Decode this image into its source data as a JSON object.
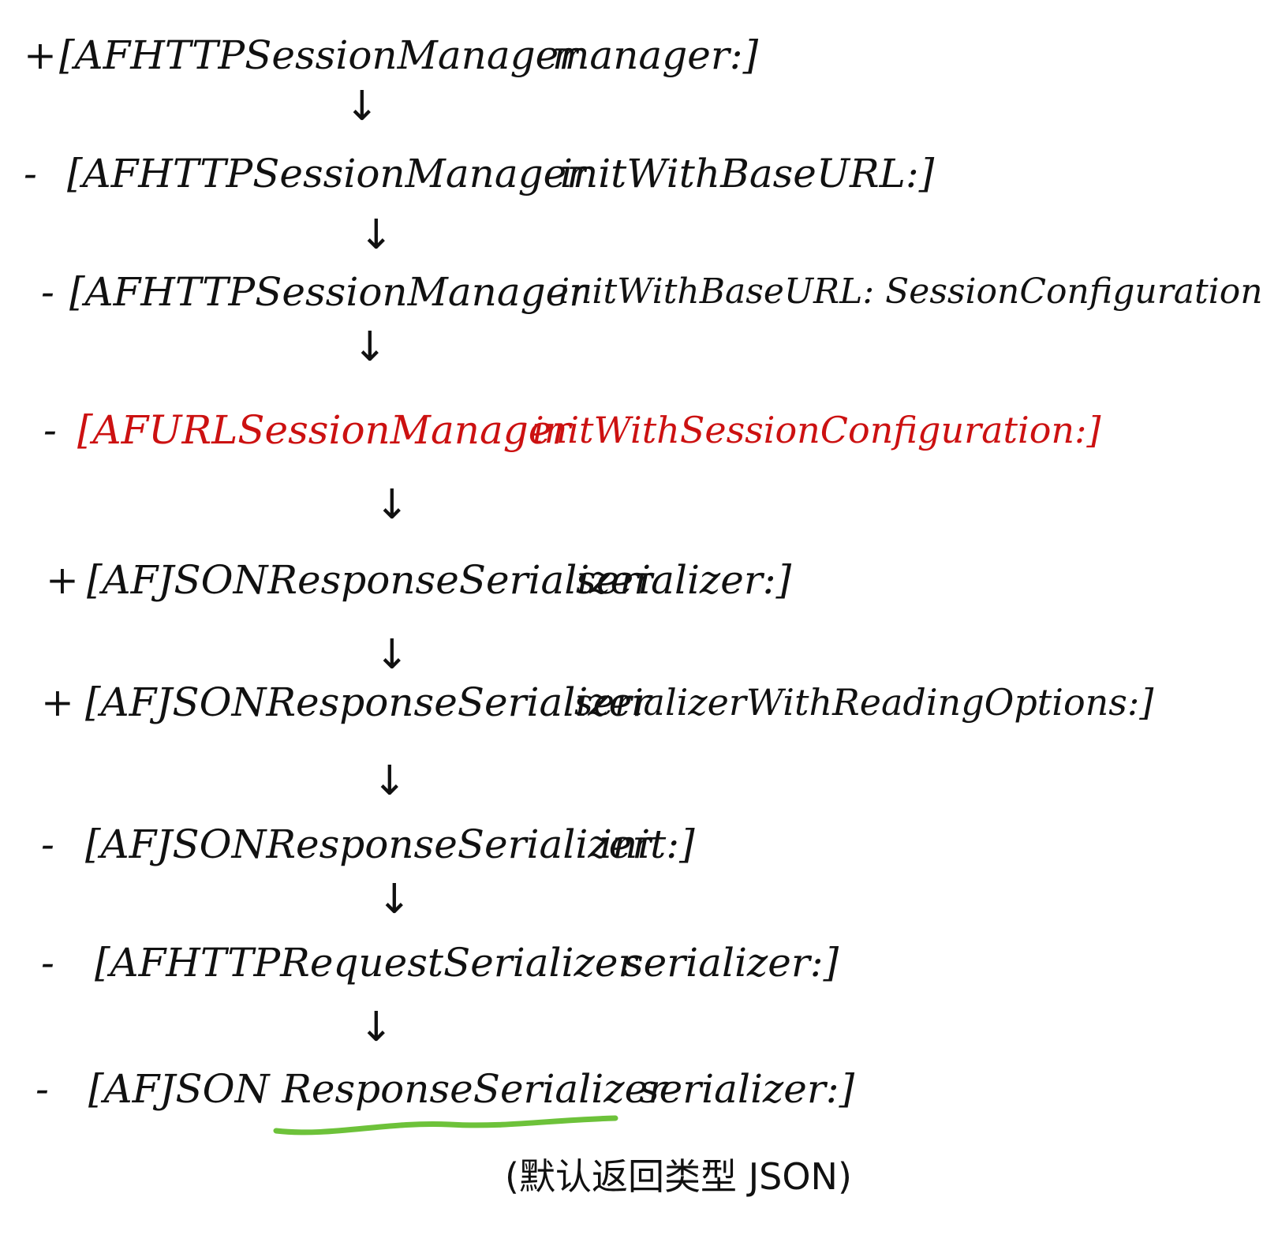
{
  "chart_data": null,
  "diagram": {
    "steps": [
      {
        "prefix": "+",
        "class": "[AFHTTPSessionManager",
        "selector": "manager:]",
        "highlight": false
      },
      {
        "prefix": "-",
        "class": "[AFHTTPSessionManager",
        "selector": "initWithBaseURL:]",
        "highlight": false
      },
      {
        "prefix": "-",
        "class": "[AFHTTPSessionManager",
        "selector": "initWithBaseURL: SessionConfiguration:]",
        "highlight": false
      },
      {
        "prefix": "-",
        "class": "[AFURLSessionManager",
        "selector": "initWithSessionConfiguration:]",
        "highlight": true
      },
      {
        "prefix": "+",
        "class": "[AFJSONResponseSerializer",
        "selector": "serializer:]",
        "highlight": false
      },
      {
        "prefix": "+",
        "class": "[AFJSONResponseSerializer",
        "selector": "serializerWithReadingOptions:]",
        "highlight": false
      },
      {
        "prefix": "-",
        "class": "[AFJSONResponseSerializer",
        "selector": "init:]",
        "highlight": false
      },
      {
        "prefix": "-",
        "class": "[AFHTTPRequestSerializer",
        "selector": "serializer:]",
        "highlight": false
      },
      {
        "prefix": "-",
        "class": "[AFJSON ResponseSerializer",
        "selector": "serializer:]",
        "highlight": false
      }
    ],
    "arrow_glyph": "↓",
    "underlined_text": "ResponseSerializer",
    "note": "(默认返回类型 JSON)",
    "colors": {
      "ink": "#111111",
      "highlight": "#cc1111",
      "underline": "#6dc23a"
    }
  }
}
